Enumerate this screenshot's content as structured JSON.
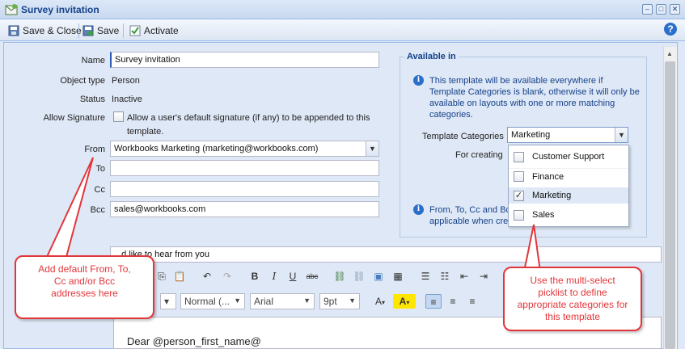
{
  "window": {
    "title": "Survey invitation"
  },
  "toolbar": {
    "save_close": "Save & Close",
    "save": "Save",
    "activate": "Activate",
    "help": "?"
  },
  "form": {
    "name_label": "Name",
    "name_value": "Survey invitation",
    "object_type_label": "Object type",
    "object_type_value": "Person",
    "status_label": "Status",
    "status_value": "Inactive",
    "allow_sig_label": "Allow Signature",
    "allow_sig_text_1": "Allow a user's default signature (if any) to be appended to this",
    "allow_sig_text_2": "template.",
    "from_label": "From",
    "from_value": "Workbooks Marketing (marketing@workbooks.com)",
    "to_label": "To",
    "to_value": "",
    "cc_label": "Cc",
    "cc_value": "",
    "bcc_label": "Bcc",
    "bcc_value": "sales@workbooks.com",
    "subject_value": "...d like to hear from you"
  },
  "available_in": {
    "legend": "Available in",
    "info_1": "This template will be available everywhere if",
    "info_2": "Template Categories is blank, otherwise it will only be",
    "info_3": "available on layouts with one or more matching",
    "info_4": "categories.",
    "categories_label": "Template Categories",
    "categories_value": "Marketing",
    "for_creating_label": "For creating",
    "info2_1": "From, To, Cc and Bc",
    "info2_2": "applicable when crea",
    "options": [
      {
        "label": "Customer Support",
        "checked": false
      },
      {
        "label": "Finance",
        "checked": false
      },
      {
        "label": "Marketing",
        "checked": true
      },
      {
        "label": "Sales",
        "checked": false
      }
    ]
  },
  "editor": {
    "format_value": "Normal (...",
    "font_value": "Arial",
    "size_value": "9pt",
    "body_text": "Dear @person_first_name@"
  },
  "callouts": {
    "left": "Add default From, To, Cc and/or Bcc addresses here",
    "right": "Use the multi-select picklist to define appropriate categories for this template"
  },
  "colors": {
    "accent": "#15428b",
    "callout": "#e2363a",
    "panel": "#dfe8f6"
  }
}
